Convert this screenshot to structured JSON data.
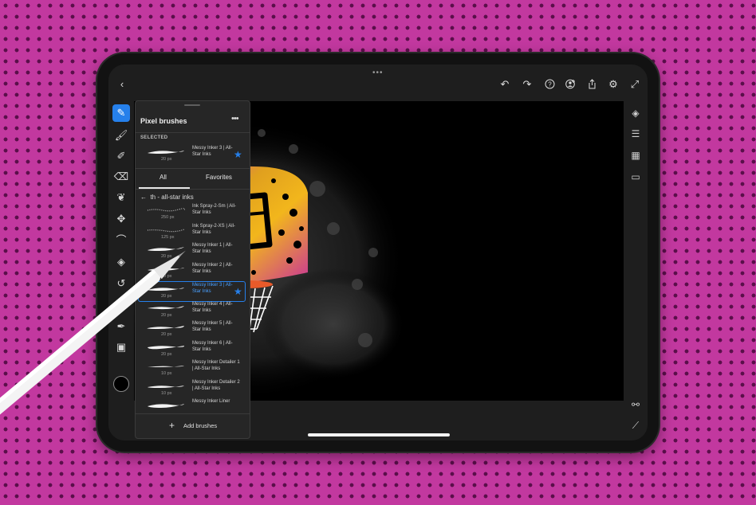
{
  "panel": {
    "title": "Pixel brushes",
    "more_label": "•••",
    "selected_heading": "SELECTED",
    "selected_brush": {
      "size": "20 px",
      "name": "Messy Inker 3 | All-Star Inks",
      "favorite": true
    },
    "tabs": [
      {
        "label": "All",
        "active": true
      },
      {
        "label": "Favorites",
        "active": false
      }
    ],
    "back_label": "th - all-star inks",
    "brushes": [
      {
        "name": "Ink Spray-2-Sm | All-Star Inks",
        "size": "250 px",
        "selected": false,
        "favorite": false
      },
      {
        "name": "Ink Spray-2-XS | All-Star Inks",
        "size": "125 px",
        "selected": false,
        "favorite": false
      },
      {
        "name": "Messy Inker 1 | All-Star Inks",
        "size": "20 px",
        "selected": false,
        "favorite": false
      },
      {
        "name": "Messy Inker 2 | All-Star Inks",
        "size": "20 px",
        "selected": false,
        "favorite": false
      },
      {
        "name": "Messy Inker 3 | All-Star Inks",
        "size": "20 px",
        "selected": true,
        "favorite": true
      },
      {
        "name": "Messy Inker 4 | All-Star Inks",
        "size": "20 px",
        "selected": false,
        "favorite": false
      },
      {
        "name": "Messy Inker 5 | All-Star Inks",
        "size": "20 px",
        "selected": false,
        "favorite": false
      },
      {
        "name": "Messy Inker 6 | All-Star Inks",
        "size": "20 px",
        "selected": false,
        "favorite": false
      },
      {
        "name": "Messy Inker Detailer 1 | All-Star Inks",
        "size": "10 px",
        "selected": false,
        "favorite": false
      },
      {
        "name": "Messy Inker Detailer 2 | All-Star Inks",
        "size": "10 px",
        "selected": false,
        "favorite": false
      },
      {
        "name": "Messy Inker Liner",
        "size": "",
        "selected": false,
        "favorite": false
      }
    ],
    "add_label": "Add brushes"
  },
  "left_tools": [
    "brush-tool-icon",
    "smudge-brush-icon",
    "mixer-brush-icon",
    "eraser-icon",
    "liquify-icon",
    "transform-icon",
    "lasso-select-icon",
    "fill-icon",
    "undo-history-icon",
    "eyedropper-icon",
    "place-image-icon"
  ],
  "colors": {
    "accent": "#2680eb",
    "current_color": "#000000"
  }
}
